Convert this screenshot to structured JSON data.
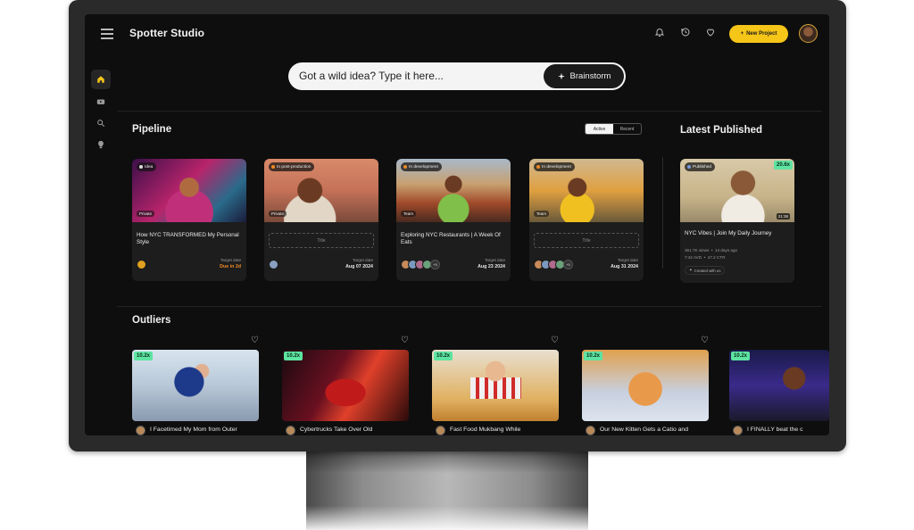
{
  "app": {
    "brand": "Spotter Studio",
    "new_project_label": "New Project"
  },
  "header_icons": [
    "bell-icon",
    "history-icon",
    "heart-icon"
  ],
  "sidebar": {
    "items": [
      "home-icon",
      "youtube-icon",
      "search-zoom-icon",
      "lightbulb-icon"
    ]
  },
  "search": {
    "placeholder": "Got a wild idea? Type it here...",
    "button_label": "Brainstorm"
  },
  "pipeline": {
    "title": "Pipeline",
    "toggle": {
      "active": "Active",
      "recent": "Recent"
    },
    "cards": [
      {
        "status": "Idea",
        "privacy": "Private",
        "title": "How NYC TRANSFORMED My Personal Style",
        "target_label": "Target date",
        "target_value": "Due in 2d",
        "more": ""
      },
      {
        "status": "In post-production",
        "privacy": "Private",
        "title_placeholder": "Title",
        "target_label": "Target date",
        "target_value": "Aug 07 2024",
        "more": ""
      },
      {
        "status": "In development",
        "privacy": "Team",
        "title": "Exploring NYC Restaurants | A Week Of Eats",
        "target_label": "Target date",
        "target_value": "Aug 23 2024",
        "more": "+5"
      },
      {
        "status": "In development",
        "privacy": "Team",
        "title_placeholder": "Title",
        "target_label": "Target date",
        "target_value": "Aug 31 2024",
        "more": "+5"
      }
    ]
  },
  "latest_published": {
    "title": "Latest Published",
    "card": {
      "status": "Published",
      "multiplier": "20.6x",
      "duration": "21:38",
      "title": "NYC Vibes | Join My Daily Journey",
      "views": "361.7K views",
      "age": "14 days ago",
      "avd": "7:42 AVD",
      "ctr": "47.2 CTR",
      "created_label": "Created with us"
    }
  },
  "outliers": {
    "title": "Outliers",
    "cards": [
      {
        "multiplier": "10.2x",
        "title": "I Facetimed My Mom from Outer"
      },
      {
        "multiplier": "10.2x",
        "title": "Cybertrucks Take Over Old"
      },
      {
        "multiplier": "10.2x",
        "title": "Fast Food Mukbang While"
      },
      {
        "multiplier": "10.2x",
        "title": "Our New Kitten Gets a Catio and"
      },
      {
        "multiplier": "10.2x",
        "title": "I FINALLY beat the c"
      }
    ]
  },
  "colors": {
    "accent": "#f5c518",
    "due": "#f08a24",
    "multiplier": "#5ee3a1"
  }
}
